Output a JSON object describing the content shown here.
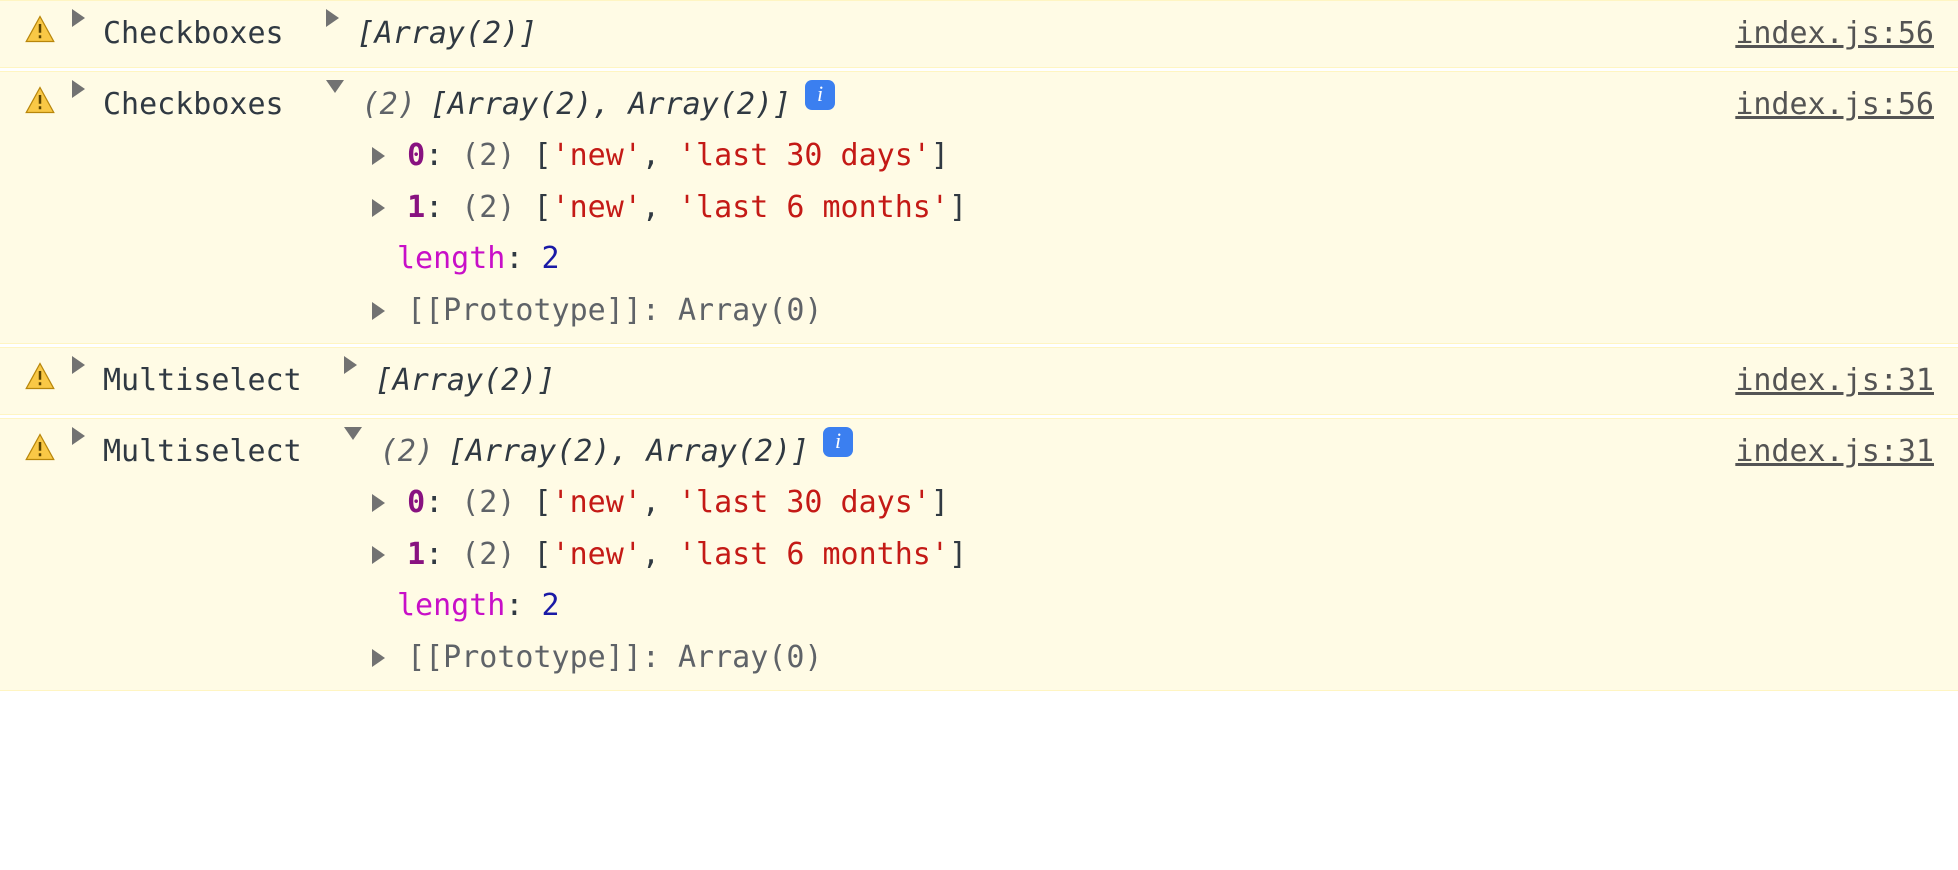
{
  "colors": {
    "background_warn": "#fffbe5",
    "key_index": "#881280",
    "length_key": "#c80fc8",
    "number": "#1a1aa6",
    "string": "#c41a16",
    "info_badge": "#3b7ff0"
  },
  "glyphs": {
    "info": "i"
  },
  "rows": [
    {
      "expanded": false,
      "label": "Checkboxes",
      "summary": "[Array(2)]",
      "source": "index.js:56"
    },
    {
      "expanded": true,
      "label": "Checkboxes",
      "count_prefix": "(2)",
      "summary_body": "[Array(2), Array(2)]",
      "source": "index.js:56",
      "items": [
        {
          "index": "0",
          "count": "(2)",
          "values": [
            "'new'",
            "'last 30 days'"
          ]
        },
        {
          "index": "1",
          "count": "(2)",
          "values": [
            "'new'",
            "'last 6 months'"
          ]
        }
      ],
      "length_label": "length",
      "length_value": "2",
      "proto_label": "[[Prototype]]",
      "proto_value": "Array(0)"
    },
    {
      "expanded": false,
      "label": "Multiselect",
      "summary": "[Array(2)]",
      "source": "index.js:31"
    },
    {
      "expanded": true,
      "label": "Multiselect",
      "count_prefix": "(2)",
      "summary_body": "[Array(2), Array(2)]",
      "source": "index.js:31",
      "items": [
        {
          "index": "0",
          "count": "(2)",
          "values": [
            "'new'",
            "'last 30 days'"
          ]
        },
        {
          "index": "1",
          "count": "(2)",
          "values": [
            "'new'",
            "'last 6 months'"
          ]
        }
      ],
      "length_label": "length",
      "length_value": "2",
      "proto_label": "[[Prototype]]",
      "proto_value": "Array(0)"
    }
  ]
}
